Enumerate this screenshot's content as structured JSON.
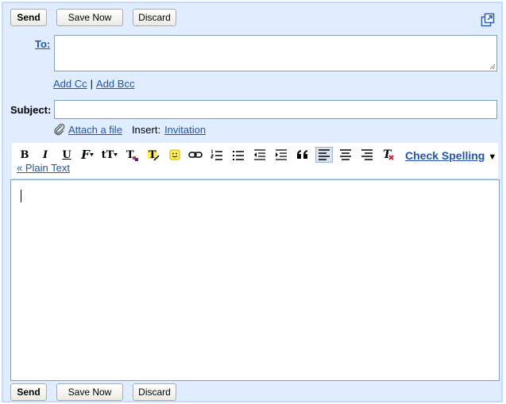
{
  "top_bar": {
    "send_label": "Send",
    "save_now_label": "Save Now",
    "discard_label": "Discard",
    "popout_icon": "popout-window-icon"
  },
  "recipients": {
    "to_label": "To:",
    "to_value": "",
    "add_cc_label": "Add Cc",
    "separator": "|",
    "add_bcc_label": "Add Bcc"
  },
  "subject": {
    "label": "Subject:",
    "value": ""
  },
  "attachments": {
    "attach_label": "Attach a file",
    "insert_label": "Insert:",
    "invitation_label": "Invitation"
  },
  "toolbar": {
    "bold": "B",
    "italic": "I",
    "underline": "U",
    "font": "F",
    "size": "tT",
    "check_spelling_label": "Check Spelling",
    "dropdown_arrow": "▼",
    "plain_text_label": "« Plain Text",
    "icons": [
      "bold-icon",
      "italic-icon",
      "underline-icon",
      "font-icon",
      "font-size-icon",
      "text-color-icon",
      "highlight-color-icon",
      "emoticon-icon",
      "link-icon",
      "numbered-list-icon",
      "bulleted-list-icon",
      "outdent-icon",
      "indent-icon",
      "quote-icon",
      "align-left-icon",
      "align-center-icon",
      "align-right-icon",
      "remove-formatting-icon"
    ]
  },
  "body": {
    "text": ""
  },
  "bottom_bar": {
    "send_label": "Send",
    "save_now_label": "Save Now",
    "discard_label": "Discard"
  }
}
